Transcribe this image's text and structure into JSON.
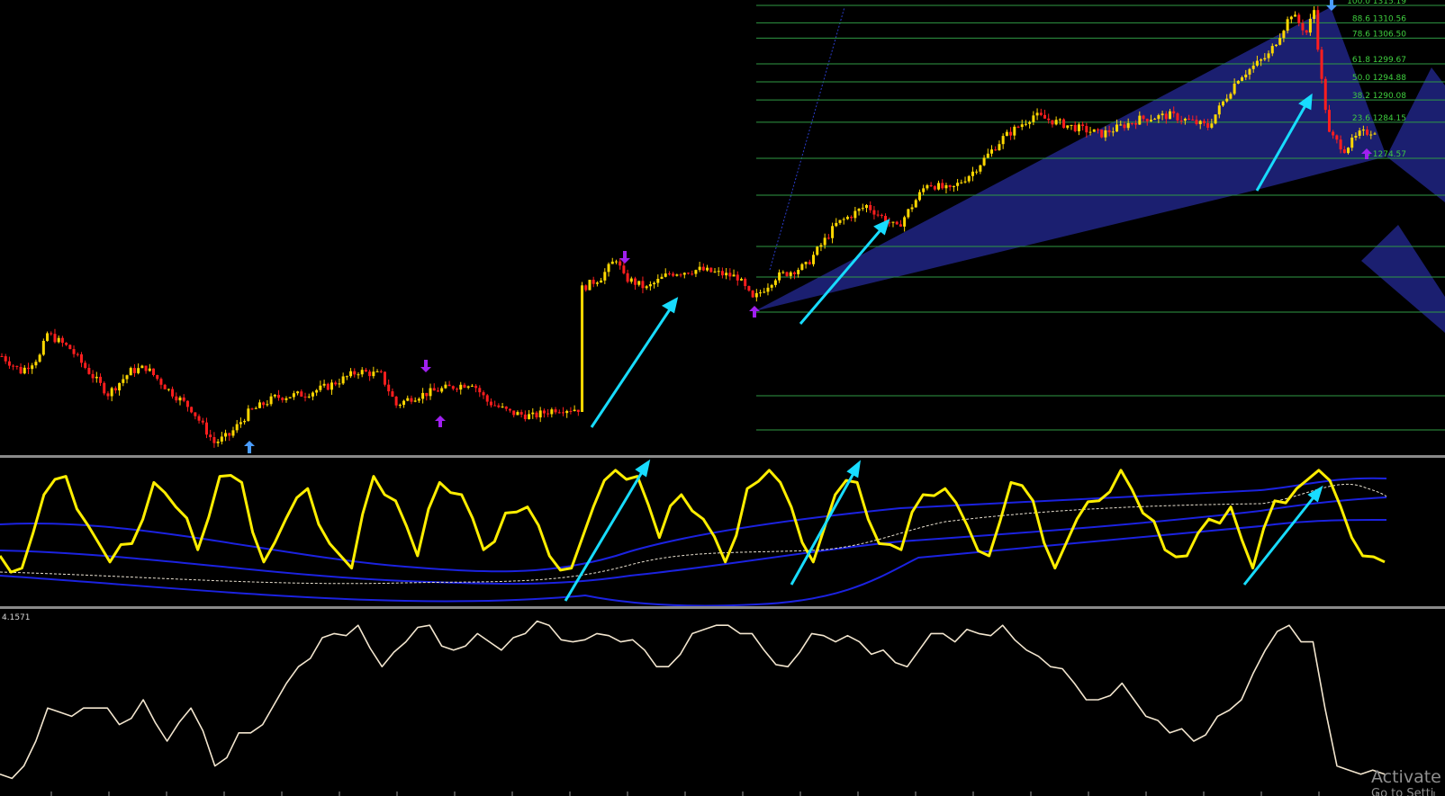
{
  "colors": {
    "background": "#000000",
    "candle_up": "#ffd800",
    "candle_down": "#ff1e1e",
    "fib_line": "#2f9a44",
    "fib_label": "#3fcf3f",
    "harmonic_fill": "#1b1f70",
    "arrow": "#18dcff",
    "fractal_down": "#a020f0",
    "fractal_up_blue": "#4a9dff",
    "oscillator": "#ffee00",
    "bands": "#1b22e0",
    "signal": "#e8e0d0",
    "lower_line": "#f3e6cf",
    "separator": "#8a8a8a"
  },
  "price_panel": {
    "fib_levels": [
      {
        "label": "100.0 1315.19",
        "level": 100.0,
        "price": 1315.19
      },
      {
        "label": "88.6 1310.56",
        "level": 88.6,
        "price": 1310.56
      },
      {
        "label": "78.6 1306.50",
        "level": 78.6,
        "price": 1306.5
      },
      {
        "label": "61.8 1299.67",
        "level": 61.8,
        "price": 1299.67
      },
      {
        "label": "50.0 1294.88",
        "level": 50.0,
        "price": 1294.88
      },
      {
        "label": "38.2 1290.08",
        "level": 38.2,
        "price": 1290.08
      },
      {
        "label": "23.6 1284.15",
        "level": 23.6,
        "price": 1284.15
      },
      {
        "label": "0 1274.57",
        "level": 0,
        "price": 1274.57
      }
    ]
  },
  "indicator_panel_2": {
    "label": "4.1571"
  },
  "watermark": {
    "line1": "Activate V",
    "line2": "Go to Setti"
  },
  "chart_data": [
    {
      "type": "candlestick",
      "title": "",
      "series": [
        {
          "name": "",
          "description_points": [
            {
              "t": 0,
              "p": 1222
            },
            {
              "t": 5,
              "p": 1218
            },
            {
              "t": 10,
              "p": 1222
            },
            {
              "t": 12,
              "p": 1228
            },
            {
              "t": 18,
              "p": 1224
            },
            {
              "t": 22,
              "p": 1219
            },
            {
              "t": 28,
              "p": 1212
            },
            {
              "t": 34,
              "p": 1218
            },
            {
              "t": 38,
              "p": 1219
            },
            {
              "t": 44,
              "p": 1213
            },
            {
              "t": 50,
              "p": 1208
            },
            {
              "t": 56,
              "p": 1199
            },
            {
              "t": 60,
              "p": 1201
            },
            {
              "t": 65,
              "p": 1207
            },
            {
              "t": 72,
              "p": 1211
            },
            {
              "t": 80,
              "p": 1212
            },
            {
              "t": 86,
              "p": 1214
            },
            {
              "t": 94,
              "p": 1218
            },
            {
              "t": 100,
              "p": 1217
            },
            {
              "t": 104,
              "p": 1209
            },
            {
              "t": 108,
              "p": 1211
            },
            {
              "t": 115,
              "p": 1213
            },
            {
              "t": 124,
              "p": 1215
            },
            {
              "t": 128,
              "p": 1210
            },
            {
              "t": 134,
              "p": 1207
            },
            {
              "t": 140,
              "p": 1206
            },
            {
              "t": 146,
              "p": 1208
            },
            {
              "t": 152,
              "p": 1208
            },
            {
              "t": 153,
              "p": 1240
            },
            {
              "t": 158,
              "p": 1243
            },
            {
              "t": 162,
              "p": 1248
            },
            {
              "t": 164,
              "p": 1243
            },
            {
              "t": 170,
              "p": 1240
            },
            {
              "t": 176,
              "p": 1244
            },
            {
              "t": 184,
              "p": 1245
            },
            {
              "t": 194,
              "p": 1243
            },
            {
              "t": 198,
              "p": 1237
            },
            {
              "t": 204,
              "p": 1243
            },
            {
              "t": 212,
              "p": 1246
            },
            {
              "t": 220,
              "p": 1257
            },
            {
              "t": 228,
              "p": 1262
            },
            {
              "t": 236,
              "p": 1256
            },
            {
              "t": 244,
              "p": 1268
            },
            {
              "t": 250,
              "p": 1266
            },
            {
              "t": 256,
              "p": 1271
            },
            {
              "t": 264,
              "p": 1280
            },
            {
              "t": 272,
              "p": 1286
            },
            {
              "t": 282,
              "p": 1283
            },
            {
              "t": 290,
              "p": 1281
            },
            {
              "t": 300,
              "p": 1285
            },
            {
              "t": 308,
              "p": 1286
            },
            {
              "t": 318,
              "p": 1283
            },
            {
              "t": 326,
              "p": 1296
            },
            {
              "t": 334,
              "p": 1302
            },
            {
              "t": 340,
              "p": 1313
            },
            {
              "t": 344,
              "p": 1308
            },
            {
              "t": 346,
              "p": 1314
            },
            {
              "t": 348,
              "p": 1295
            },
            {
              "t": 350,
              "p": 1281
            },
            {
              "t": 354,
              "p": 1277
            },
            {
              "t": 358,
              "p": 1281
            },
            {
              "t": 362,
              "p": 1282
            }
          ]
        }
      ]
    },
    {
      "type": "line",
      "title": "",
      "series": [
        {
          "name": "",
          "values": [
            0.25,
            0.15,
            0.75,
            0.9,
            0.5,
            0.2,
            0.35,
            0.85,
            0.65,
            0.3,
            0.9,
            0.85,
            0.2,
            0.55,
            0.8,
            0.35,
            0.15,
            0.9,
            0.7,
            0.25,
            0.85,
            0.75,
            0.3,
            0.6,
            0.65,
            0.25,
            0.15,
            0.65,
            0.95,
            0.9,
            0.4,
            0.75,
            0.55,
            0.2,
            0.8,
            0.95,
            0.65,
            0.2,
            0.75,
            0.85,
            0.35,
            0.3,
            0.75,
            0.8,
            0.5,
            0.25,
            0.85,
            0.7,
            0.15,
            0.55,
            0.7,
            0.95,
            0.6,
            0.3,
            0.25,
            0.55,
            0.65,
            0.15,
            0.7,
            0.8,
            0.95,
            0.65,
            0.25,
            0.2
          ]
        }
      ]
    },
    {
      "type": "line",
      "title": "",
      "series": [
        {
          "name": "",
          "values": [
            0.05,
            0.1,
            0.45,
            0.4,
            0.45,
            0.35,
            0.5,
            0.25,
            0.45,
            0.1,
            0.3,
            0.35,
            0.6,
            0.75,
            0.9,
            0.95,
            0.7,
            0.85,
            0.95,
            0.8,
            0.9,
            0.8,
            0.9,
            0.95,
            0.85,
            0.9,
            0.85,
            0.8,
            0.7,
            0.9,
            0.95,
            0.9,
            0.8,
            0.7,
            0.9,
            0.85,
            0.85,
            0.8,
            0.7,
            0.9,
            0.85,
            0.9,
            0.95,
            0.8,
            0.7,
            0.6,
            0.5,
            0.6,
            0.4,
            0.3,
            0.25,
            0.4,
            0.5,
            0.8,
            0.95,
            0.85,
            0.1,
            0.05,
            0.05
          ]
        }
      ]
    }
  ]
}
